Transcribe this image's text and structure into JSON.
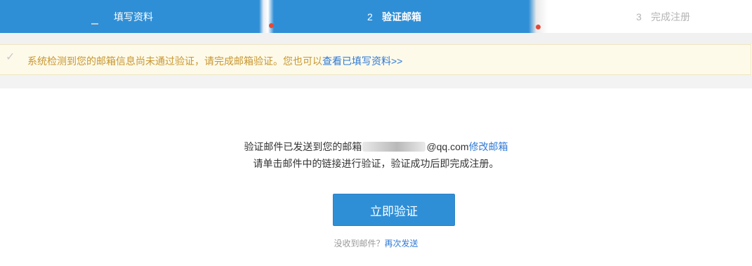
{
  "steps": [
    {
      "number": "",
      "label": "填写资料"
    },
    {
      "number": "2",
      "label": "验证邮箱"
    },
    {
      "number": "3",
      "label": "完成注册"
    }
  ],
  "notice": {
    "check_icon": "check-icon",
    "text": "系统检测到您的邮箱信息尚未通过验证，请完成邮箱验证。您也可以",
    "link": "查看已填写资料>>"
  },
  "main": {
    "line1_prefix": "验证邮件已发送到您的邮箱",
    "email_suffix": "@qq.com",
    "edit_email": "修改邮箱",
    "line2": "请单击邮件中的链接进行验证，验证成功后即完成注册。",
    "verify_button": "立即验证",
    "resend_prompt": "没收到邮件？",
    "resend_link": "再次发送"
  },
  "colors": {
    "primary": "#2f8fd6",
    "link": "#2f79d6",
    "notice_text": "#c9962e",
    "notice_bg": "#fdfaea"
  }
}
